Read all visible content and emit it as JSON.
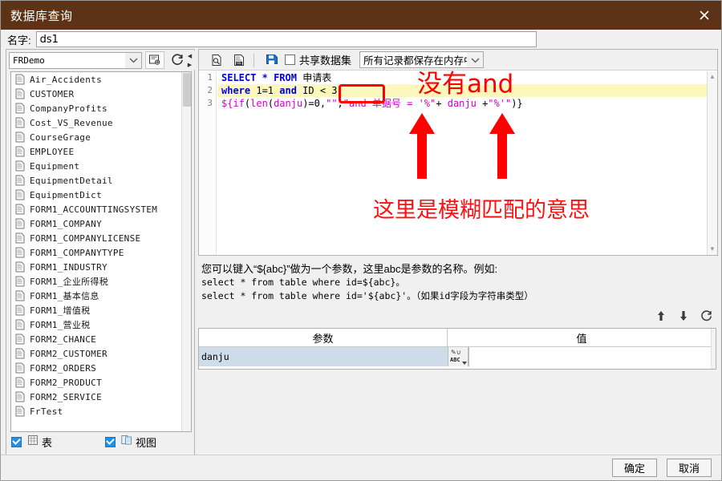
{
  "window": {
    "title": "数据库查询",
    "close_label": "×",
    "titlebar_color": "#5c3317"
  },
  "name_field": {
    "label": "名字:",
    "value": "ds1",
    "placeholder": ""
  },
  "left_panel": {
    "connection": {
      "value": "FRDemo",
      "dropdown_icon": "chevron-down-icon",
      "config_icon": "database-config-icon",
      "refresh_icon": "refresh-icon"
    },
    "tables": [
      "Air_Accidents",
      "CUSTOMER",
      "CompanyProfits",
      "Cost_VS_Revenue",
      "CourseGrage",
      "EMPLOYEE",
      "Equipment",
      "EquipmentDetail",
      "EquipmentDict",
      "FORM1_ACCOUNTTINGSYSTEM",
      "FORM1_COMPANY",
      "FORM1_COMPANYLICENSE",
      "FORM1_COMPANYTYPE",
      "FORM1_INDUSTRY",
      "FORM1_企业所得税",
      "FORM1_基本信息",
      "FORM1_增值税",
      "FORM1_营业税",
      "FORM2_CHANCE",
      "FORM2_CUSTOMER",
      "FORM2_ORDERS",
      "FORM2_PRODUCT",
      "FORM2_SERVICE",
      "FrTest"
    ],
    "filters": [
      {
        "label": "表",
        "checked": true,
        "icon": "table-icon"
      },
      {
        "label": "视图",
        "checked": true,
        "icon": "view-icon"
      }
    ]
  },
  "toolbar": {
    "preview_icon": "preview-sql-icon",
    "sql_icon": "sql-doc-icon",
    "save_icon": "save-icon",
    "shared_dataset": {
      "label": "共享数据集",
      "checked": false
    },
    "storage_mode": {
      "value": "所有记录都保存在内存中",
      "dropdown_icon": "chevron-down-icon"
    }
  },
  "editor": {
    "line_numbers": [
      "1",
      "2",
      "3"
    ],
    "highlighted_line": 2,
    "lines": [
      [
        {
          "t": "SELECT",
          "c": "kw"
        },
        {
          "t": " ",
          "c": "plain"
        },
        {
          "t": "*",
          "c": "kw"
        },
        {
          "t": " ",
          "c": "plain"
        },
        {
          "t": "FROM",
          "c": "kw"
        },
        {
          "t": " 申请表",
          "c": "plain"
        }
      ],
      [
        {
          "t": "where",
          "c": "kw"
        },
        {
          "t": " 1=1 ",
          "c": "plain"
        },
        {
          "t": "and",
          "c": "kw"
        },
        {
          "t": " ID ",
          "c": "plain"
        },
        {
          "t": "<",
          "c": "plain"
        },
        {
          "t": " 3",
          "c": "plain"
        }
      ],
      [
        {
          "t": "${",
          "c": "mag"
        },
        {
          "t": "if",
          "c": "mag"
        },
        {
          "t": "(",
          "c": "blk"
        },
        {
          "t": "len",
          "c": "mag"
        },
        {
          "t": "(",
          "c": "blk"
        },
        {
          "t": "danju",
          "c": "mag"
        },
        {
          "t": ")=0,",
          "c": "blk"
        },
        {
          "t": "\"\"",
          "c": "mag"
        },
        {
          "t": ",",
          "c": "blk"
        },
        {
          "t": "\"and 单据号 = '%\"",
          "c": "mag"
        },
        {
          "t": "+ ",
          "c": "blk"
        },
        {
          "t": "danju",
          "c": "mag"
        },
        {
          "t": " +",
          "c": "blk"
        },
        {
          "t": "\"%'\"",
          "c": "mag"
        },
        {
          "t": ")}",
          "c": "blk"
        }
      ]
    ],
    "raw_text": "SELECT * FROM 申请表\nwhere 1=1 and ID < 3\n${if(len(danju)=0,\"\",\"and 单据号 = '%\"+ danju +\"%'\")}"
  },
  "help": {
    "line1": "您可以键入“${abc}”做为一个参数，这里abc是参数的名称。例如:",
    "line2": "select * from table where id=${abc}。",
    "line3": "select * from table where id='${abc}'。（如果id字段为字符串类型）"
  },
  "param_actions": [
    {
      "icon": "arrow-up-icon",
      "glyph": "↑"
    },
    {
      "icon": "arrow-down-icon",
      "glyph": "↓"
    },
    {
      "icon": "refresh-icon",
      "glyph": "↻"
    }
  ],
  "param_table": {
    "columns": [
      "参数",
      "值"
    ],
    "rows": [
      {
        "name": "danju",
        "type_icon": "abc-type-icon",
        "type_label": "ABC",
        "value": ""
      }
    ]
  },
  "footer": {
    "ok_label": "确定",
    "cancel_label": "取消"
  },
  "annotations": {
    "note_no_and": "没有and",
    "note_fuzzy_match": "这里是模糊匹配的意思",
    "color": "#ff0000"
  }
}
